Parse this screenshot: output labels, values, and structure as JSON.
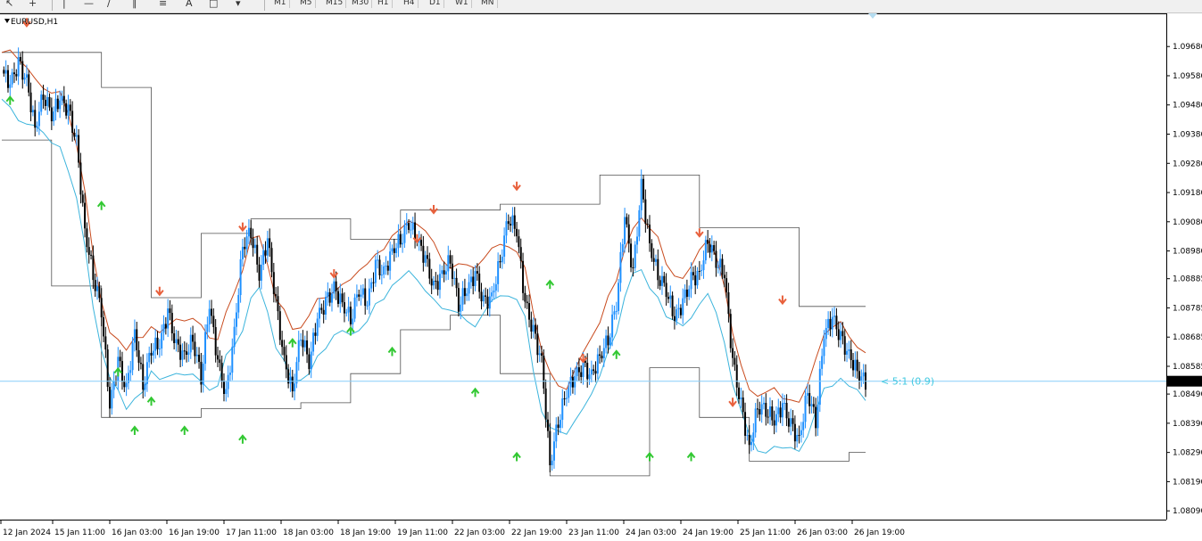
{
  "toolbar": {
    "timeframes": [
      "M1",
      "M5",
      "M15",
      "M30",
      "H1",
      "H4",
      "D1",
      "W1",
      "MN"
    ]
  },
  "chart": {
    "symbol_label": "EURUSD,H1",
    "current_price_label": "1.08534",
    "annotation_text": "< 5:1 (0.9)",
    "colors": {
      "bull_candle": "#1e90ff",
      "bear_candle": "#000000",
      "upper_ma": "#c84b1e",
      "lower_ma": "#3cb4dc",
      "channel": "#505050",
      "sell_arrow": "#e8603c",
      "buy_arrow": "#32c832",
      "price_line": "#87cefa"
    }
  },
  "chart_data": {
    "type": "candlestick",
    "symbol": "EURUSD",
    "timeframe": "H1",
    "y_ticks": [
      "1.09680",
      "1.09580",
      "1.09480",
      "1.09380",
      "1.09280",
      "1.09180",
      "1.09080",
      "1.08980",
      "1.08885",
      "1.08785",
      "1.08685",
      "1.08585",
      "1.08490",
      "1.08390",
      "1.08290",
      "1.08190",
      "1.08090"
    ],
    "ylim": [
      1.0806,
      1.0976
    ],
    "x_labels": [
      "12 Jan 2024",
      "15 Jan 11:00",
      "16 Jan 03:00",
      "16 Jan 19:00",
      "17 Jan 11:00",
      "18 Jan 03:00",
      "18 Jan 19:00",
      "19 Jan 11:00",
      "22 Jan 03:00",
      "22 Jan 19:00",
      "23 Jan 11:00",
      "24 Jan 03:00",
      "24 Jan 19:00",
      "25 Jan 11:00",
      "26 Jan 03:00",
      "26 Jan 19:00"
    ],
    "current_price": 1.08534,
    "price_path": [
      1.096,
      1.0955,
      1.0962,
      1.0956,
      1.094,
      1.0952,
      1.0945,
      1.095,
      1.0946,
      1.0935,
      1.0905,
      1.089,
      1.0878,
      1.0845,
      1.086,
      1.085,
      1.087,
      1.0852,
      1.0865,
      1.0866,
      1.0877,
      1.0865,
      1.0862,
      1.0868,
      1.0855,
      1.088,
      1.086,
      1.0848,
      1.087,
      1.09,
      1.0905,
      1.089,
      1.0902,
      1.088,
      1.086,
      1.085,
      1.087,
      1.086,
      1.0875,
      1.088,
      1.0885,
      1.088,
      1.0875,
      1.0885,
      1.088,
      1.0893,
      1.089,
      1.0898,
      1.0902,
      1.0908,
      1.0902,
      1.0895,
      1.0885,
      1.089,
      1.0895,
      1.088,
      1.0885,
      1.089,
      1.088,
      1.0882,
      1.0895,
      1.091,
      1.0905,
      1.088,
      1.087,
      1.086,
      1.0825,
      1.084,
      1.085,
      1.0855,
      1.0858,
      1.0855,
      1.0862,
      1.0868,
      1.088,
      1.091,
      1.089,
      1.092,
      1.09,
      1.089,
      1.0885,
      1.0875,
      1.088,
      1.0888,
      1.089,
      1.0902,
      1.0895,
      1.089,
      1.086,
      1.0845,
      1.083,
      1.0845,
      1.0844,
      1.084,
      1.0845,
      1.0838,
      1.0833,
      1.085,
      1.084,
      1.087,
      1.0875,
      1.0868,
      1.0862,
      1.0857,
      1.0853
    ],
    "sell_arrows": [
      1.0975,
      1.0883,
      1.0905,
      1.0889,
      1.0901,
      1.0911,
      1.0919,
      1.086,
      1.0903,
      1.0845,
      1.088
    ],
    "buy_arrows": [
      1.0948,
      1.0912,
      1.0855,
      1.0835,
      1.0845,
      1.0835,
      1.0832,
      1.0865,
      1.0869,
      1.0862,
      1.0848,
      1.0826,
      1.0885,
      1.0861,
      1.0826,
      1.0826
    ]
  }
}
